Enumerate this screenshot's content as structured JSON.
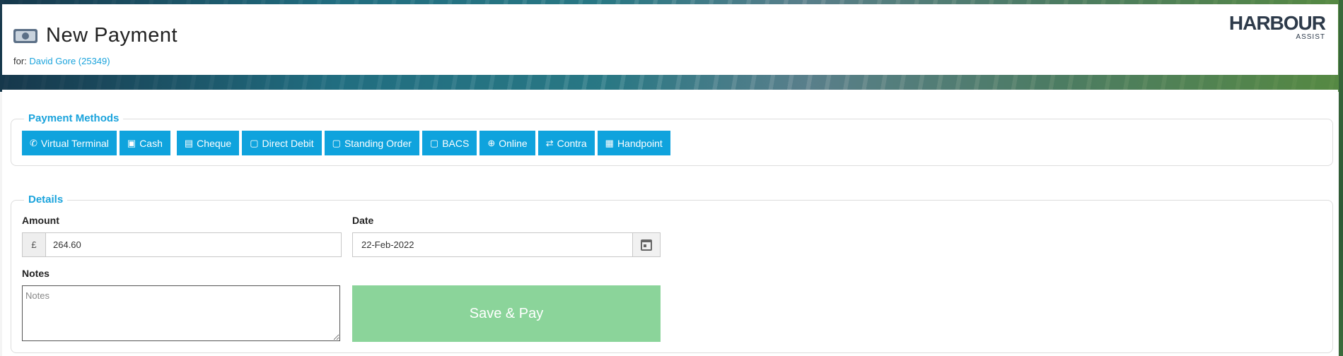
{
  "header": {
    "title": "New Payment",
    "for_prefix": "for:",
    "customer_link": "David Gore (25349)",
    "logo_main": "HARBOUR",
    "logo_sub": "ASSIST"
  },
  "payment_methods": {
    "legend": "Payment Methods",
    "items": [
      {
        "label": "Virtual Terminal",
        "icon": "phone-icon"
      },
      {
        "label": "Cash",
        "icon": "money-icon"
      },
      {
        "label": "Cheque",
        "icon": "cheque-icon"
      },
      {
        "label": "Direct Debit",
        "icon": "calendar-icon"
      },
      {
        "label": "Standing Order",
        "icon": "calendar-icon"
      },
      {
        "label": "BACS",
        "icon": "calendar-icon"
      },
      {
        "label": "Online",
        "icon": "globe-icon"
      },
      {
        "label": "Contra",
        "icon": "exchange-icon"
      },
      {
        "label": "Handpoint",
        "icon": "calculator-icon"
      }
    ]
  },
  "details": {
    "legend": "Details",
    "amount_label": "Amount",
    "currency_symbol": "£",
    "amount_value": "264.60",
    "date_label": "Date",
    "date_value": "22-Feb-2022",
    "notes_label": "Notes",
    "notes_placeholder": "Notes",
    "save_label": "Save & Pay"
  },
  "colors": {
    "accent": "#0fa3dd",
    "save_button": "#8bd49a"
  }
}
